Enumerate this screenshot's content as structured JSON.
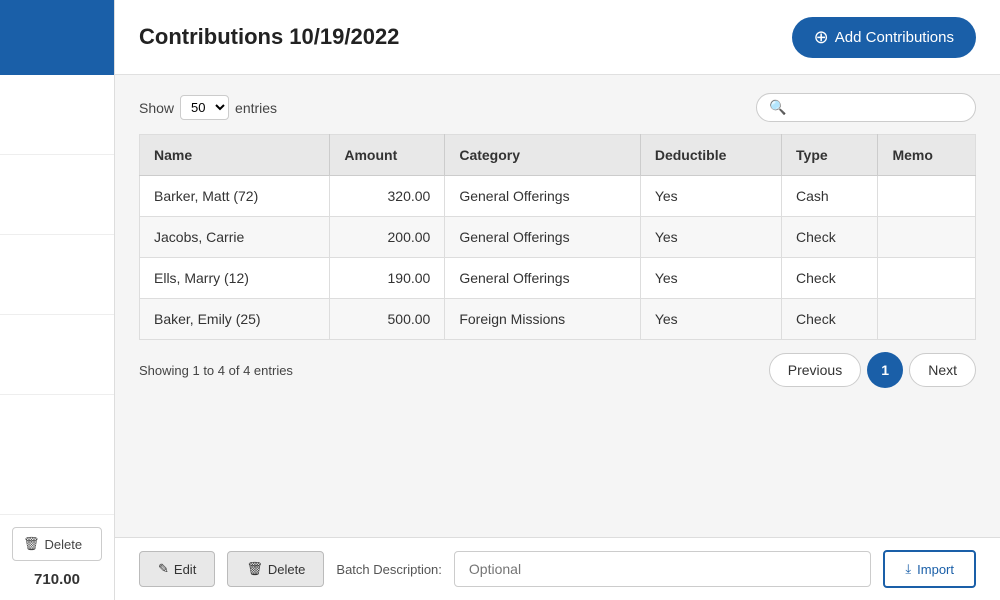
{
  "sidebar": {
    "delete_label": "Delete",
    "total": "710.00"
  },
  "header": {
    "title": "Contributions 10/19/2022",
    "add_button_label": "Add Contributions",
    "add_button_icon": "⊕"
  },
  "table_controls": {
    "show_label": "Show",
    "entries_label": "entries",
    "show_value": "50",
    "search_placeholder": ""
  },
  "columns": [
    "Name",
    "Amount",
    "Category",
    "Deductible",
    "Type",
    "Memo"
  ],
  "rows": [
    {
      "name": "Barker, Matt (72)",
      "amount": "320.00",
      "category": "General Offerings",
      "deductible": "Yes",
      "type": "Cash",
      "memo": ""
    },
    {
      "name": "Jacobs, Carrie",
      "amount": "200.00",
      "category": "General Offerings",
      "deductible": "Yes",
      "type": "Check",
      "memo": ""
    },
    {
      "name": "Ells, Marry (12)",
      "amount": "190.00",
      "category": "General Offerings",
      "deductible": "Yes",
      "type": "Check",
      "memo": ""
    },
    {
      "name": "Baker, Emily (25)",
      "amount": "500.00",
      "category": "Foreign Missions",
      "deductible": "Yes",
      "type": "Check",
      "memo": ""
    }
  ],
  "pagination": {
    "showing_text": "Showing 1 to 4 of 4 entries",
    "previous_label": "Previous",
    "next_label": "Next",
    "current_page": "1"
  },
  "footer": {
    "batch_label": "Batch Description:",
    "edit_label": "Edit",
    "delete_label": "Delete",
    "batch_placeholder": "Optional",
    "import_label": "Import",
    "edit_icon": "✎",
    "delete_icon": "🗑",
    "import_icon": "⤓"
  }
}
